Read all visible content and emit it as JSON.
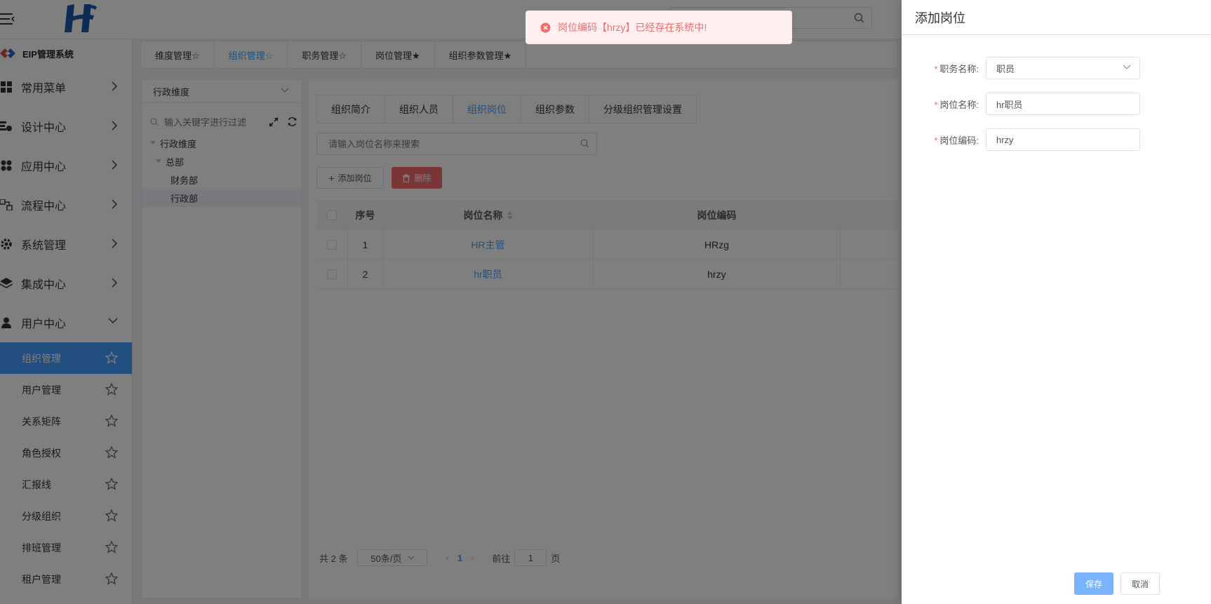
{
  "header": {
    "search_placeholder": ""
  },
  "sidebar": {
    "brand": "EIP管理系统",
    "menus": [
      {
        "label": "常用菜单",
        "icon": "grid-icon"
      },
      {
        "label": "设计中心",
        "icon": "design-icon"
      },
      {
        "label": "应用中心",
        "icon": "apps-icon"
      },
      {
        "label": "流程中心",
        "icon": "flow-icon"
      },
      {
        "label": "系统管理",
        "icon": "gear-icon"
      },
      {
        "label": "集成中心",
        "icon": "layers-icon"
      },
      {
        "label": "用户中心",
        "icon": "user-icon"
      }
    ],
    "subitems": [
      "组织管理",
      "用户管理",
      "关系矩阵",
      "角色授权",
      "汇报线",
      "分级组织",
      "排班管理",
      "租户管理"
    ],
    "active_subitem": "组织管理"
  },
  "tabbar": {
    "tabs": [
      "维度管理☆",
      "组织管理☆",
      "职务管理☆",
      "岗位管理★",
      "组织参数管理★"
    ],
    "active": 1
  },
  "tree": {
    "dimension": "行政维度",
    "search_placeholder": "输入关键字进行过滤",
    "nodes": [
      {
        "label": "行政维度",
        "level": 0
      },
      {
        "label": "总部",
        "level": 1
      },
      {
        "label": "财务部",
        "level": 2
      },
      {
        "label": "行政部",
        "level": 2
      }
    ],
    "selected": "行政部"
  },
  "main": {
    "tabs": [
      "组织简介",
      "组织人员",
      "组织岗位",
      "组织参数",
      "分级组织管理设置"
    ],
    "active_tab": 2,
    "search_placeholder": "请输入岗位名称来搜索",
    "add_button": "添加岗位",
    "delete_button": "删除",
    "table": {
      "headers": [
        "序号",
        "岗位名称",
        "岗位编码"
      ],
      "rows": [
        {
          "no": "1",
          "name": "HR主管",
          "code": "HRzg"
        },
        {
          "no": "2",
          "name": "hr职员",
          "code": "hrzy"
        }
      ]
    },
    "pager": {
      "total": "共 2 条",
      "page_size": "50条/页",
      "current_page": "1",
      "goto_label": "前往",
      "goto_value": "1",
      "page_suffix": "页"
    }
  },
  "drawer": {
    "title": "添加岗位",
    "fields": [
      {
        "label": "职务名称:",
        "value": "职员",
        "type": "select"
      },
      {
        "label": "岗位名称:",
        "value": "hr职员",
        "type": "input"
      },
      {
        "label": "岗位编码:",
        "value": "hrzy",
        "type": "input"
      }
    ],
    "save_button": "保存",
    "cancel_button": "取消"
  },
  "toast": {
    "message": "岗位编码【hrzy】已经存在系统中!"
  },
  "colors": {
    "primary": "#409eff",
    "danger": "#f56c6c",
    "active_sidebar": "#409eff"
  }
}
